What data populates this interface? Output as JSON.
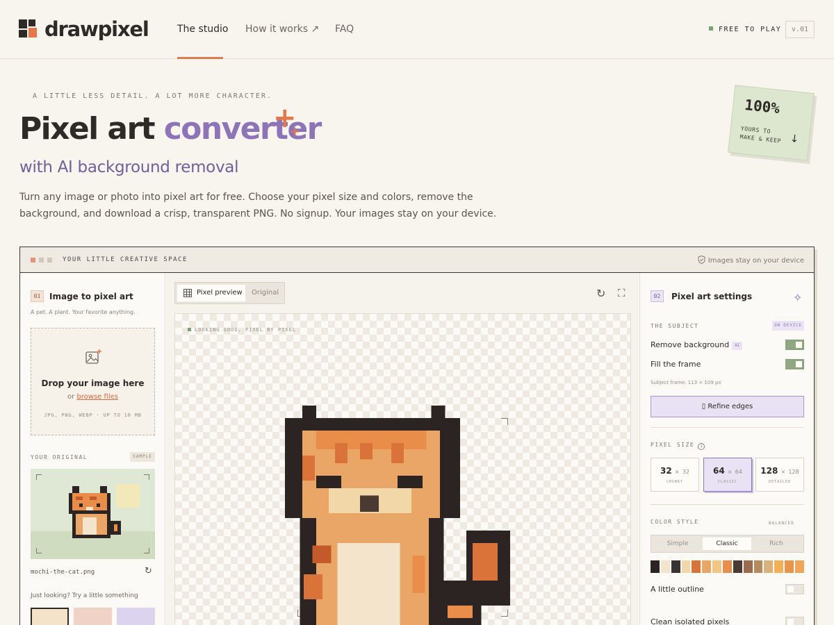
{
  "brand": {
    "name": "drawpixel"
  },
  "nav": {
    "items": [
      "The studio",
      "How it works ↗",
      "FAQ"
    ],
    "free_to_play": "FREE TO PLAY",
    "version": "v.01"
  },
  "hero": {
    "eyebrow": "A LITTLE LESS DETAIL. A LOT MORE CHARACTER.",
    "title_plain": "Pixel art ",
    "title_accent": "converter",
    "subtitle": "with AI background removal",
    "description": "Turn any image or photo into pixel art for free. Choose your pixel size and colors, remove the background, and download a crisp, transparent PNG. No signup. Your images stay on your device.",
    "sticker_big": "100%",
    "sticker_small": "YOURS TO MAKE & KEEP"
  },
  "app": {
    "bar_title": "YOUR LITTLE CREATIVE SPACE",
    "bar_right": "Images stay on your device",
    "left": {
      "step": "01",
      "title": "Image to pixel art",
      "subtitle": "A pet. A plant. Your favorite anything.",
      "drop_title": "Drop your image here",
      "drop_or": "or",
      "drop_link": "browse files",
      "drop_formats": "JPG, PNG, WEBP · UP TO 10 MB",
      "original_label": "YOUR ORIGINAL",
      "sample_badge": "SAMPLE",
      "file_name": "mochi-the-cat.png",
      "try_text": "Just looking? Try a little something"
    },
    "center": {
      "tab_preview": "Pixel preview",
      "tab_original": "Original",
      "canvas_note": "LOOKING GOOD, PIXEL BY PIXEL"
    },
    "right": {
      "step": "02",
      "title": "Pixel art settings",
      "subject_label": "THE SUBJECT",
      "on_device": "ON DEVICE",
      "remove_bg": "Remove background",
      "ai_badge": "AI",
      "fill_frame": "Fill the frame",
      "subject_frame": "Subject frame: 113 × 109 px",
      "refine": "▯ Refine edges",
      "pixel_size_label": "PIXEL SIZE",
      "sizes": [
        {
          "n": "32",
          "m": "32",
          "name": "CHUNKY"
        },
        {
          "n": "64",
          "m": "64",
          "name": "CLASSIC"
        },
        {
          "n": "128",
          "m": "128",
          "name": "DETAILED"
        }
      ],
      "selected_size": 1,
      "color_style_label": "COLOR STYLE",
      "balanced": "BALANCED",
      "styles": [
        "Simple",
        "Classic",
        "Rich"
      ],
      "selected_style": 1,
      "palette": [
        "#2b2422",
        "#f3e4cb",
        "#3a3230",
        "#f2d7a8",
        "#d9733a",
        "#eaa666",
        "#f0c785",
        "#e88d4a",
        "#4a3a33",
        "#9a6a4a",
        "#b78a5c",
        "#d8b27a",
        "#f2b056",
        "#e9964c",
        "#f1a55b"
      ],
      "outline": "A little outline",
      "clean": "Clean isolated pixels",
      "toggles": {
        "remove_bg": true,
        "fill_frame": true,
        "outline": false,
        "clean": false
      }
    }
  },
  "colors": {
    "accent_orange": "#e3784a",
    "accent_purple": "#8d74b6",
    "background": "#f8f5ef"
  }
}
